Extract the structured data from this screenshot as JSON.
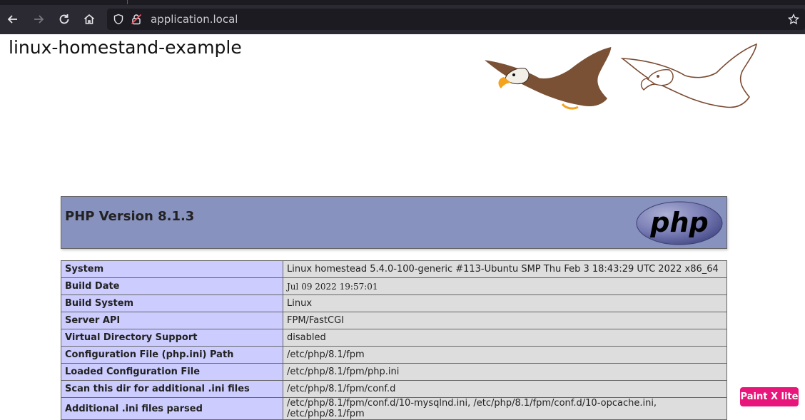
{
  "browser": {
    "url": "application.local"
  },
  "page": {
    "site_title": "linux-homestand-example"
  },
  "phpinfo": {
    "version_heading": "PHP Version 8.1.3",
    "logo_text": "php",
    "rows": [
      {
        "label": "System",
        "value": "Linux homestead 5.4.0-100-generic #113-Ubuntu SMP Thu Feb 3 18:43:29 UTC 2022 x86_64"
      },
      {
        "label": "Build Date",
        "value": "Jul 09 2022 19:57:01"
      },
      {
        "label": "Build System",
        "value": "Linux"
      },
      {
        "label": "Server API",
        "value": "FPM/FastCGI"
      },
      {
        "label": "Virtual Directory Support",
        "value": "disabled"
      },
      {
        "label": "Configuration File (php.ini) Path",
        "value": "/etc/php/8.1/fpm"
      },
      {
        "label": "Loaded Configuration File",
        "value": "/etc/php/8.1/fpm/php.ini"
      },
      {
        "label": "Scan this dir for additional .ini files",
        "value": "/etc/php/8.1/fpm/conf.d"
      },
      {
        "label": "Additional .ini files parsed",
        "value": "/etc/php/8.1/fpm/conf.d/10-mysqlnd.ini, /etc/php/8.1/fpm/conf.d/10-opcache.ini, /etc/php/8.1/fpm"
      }
    ]
  },
  "extension_badge": {
    "label": "Paint X lite"
  },
  "colors": {
    "php_header": "#8892bf",
    "label_cell": "#ccccff",
    "value_cell": "#dddddd",
    "badge": "#e8167a"
  }
}
